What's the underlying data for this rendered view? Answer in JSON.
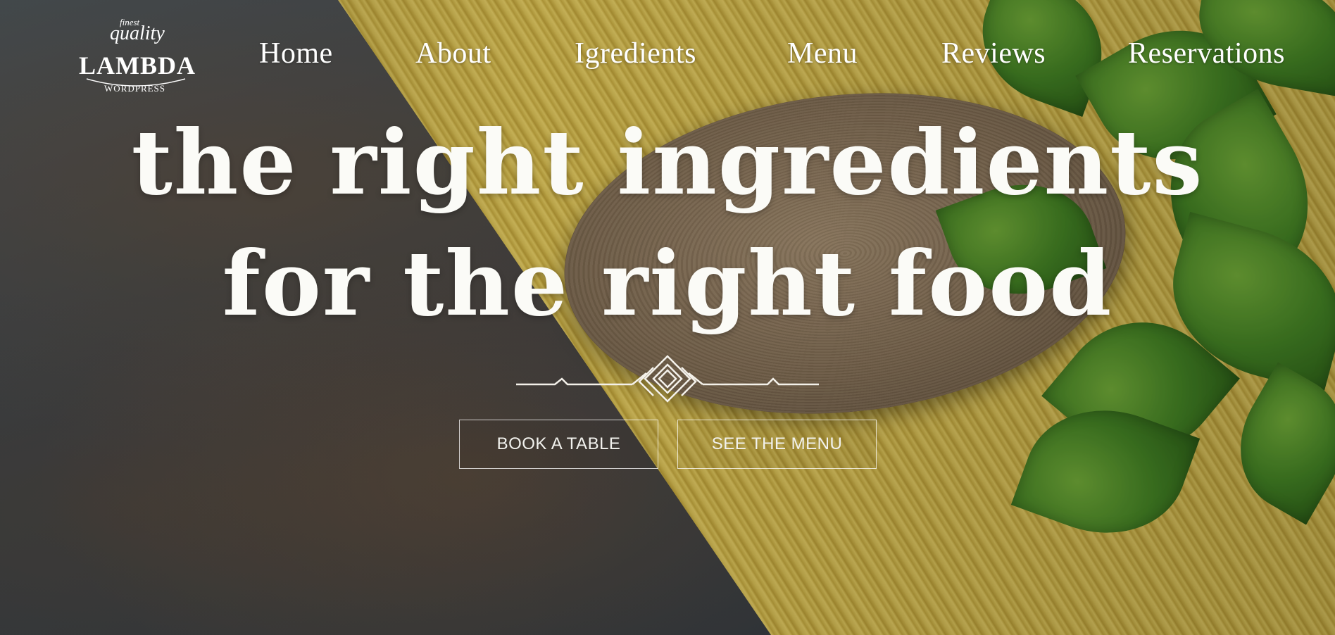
{
  "logo": {
    "fine": "finest",
    "quality": "quality",
    "name": "LAMBDA",
    "sub": "WORDPRESS"
  },
  "nav": {
    "items": [
      {
        "label": "Home"
      },
      {
        "label": "About"
      },
      {
        "label": "Igredients"
      },
      {
        "label": "Menu"
      },
      {
        "label": "Reviews"
      },
      {
        "label": "Reservations"
      }
    ]
  },
  "hero": {
    "headline_line1": "the right ingredients",
    "headline_line2": "for the right food",
    "book_button": "BOOK A TABLE",
    "menu_button": "SEE THE MENU"
  },
  "colors": {
    "text": "#ffffff",
    "button_border": "#ffffff"
  }
}
